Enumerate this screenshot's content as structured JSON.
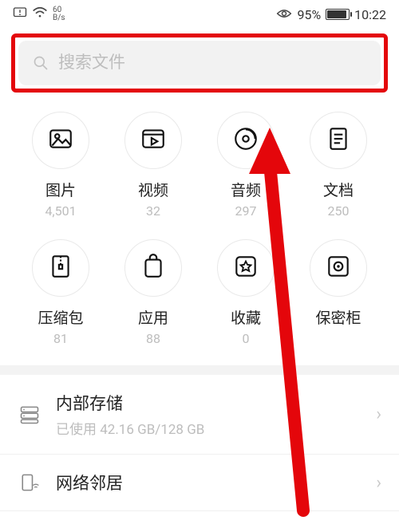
{
  "status": {
    "kbs_top": "60",
    "kbs_bot": "B/s",
    "eye_pct": "95%",
    "battery_fill_pct": 92,
    "time": "10:22"
  },
  "search": {
    "placeholder": "搜索文件"
  },
  "categories": [
    {
      "id": "images",
      "label": "图片",
      "count": "4,501"
    },
    {
      "id": "videos",
      "label": "视频",
      "count": "32"
    },
    {
      "id": "audio",
      "label": "音频",
      "count": "297"
    },
    {
      "id": "docs",
      "label": "文档",
      "count": "250"
    },
    {
      "id": "archives",
      "label": "压缩包",
      "count": "81"
    },
    {
      "id": "apps",
      "label": "应用",
      "count": "88"
    },
    {
      "id": "favs",
      "label": "收藏",
      "count": "0"
    },
    {
      "id": "safe",
      "label": "保密柜",
      "count": ""
    }
  ],
  "storage": {
    "title": "内部存储",
    "sub": "已使用 42.16 GB/128 GB"
  },
  "network": {
    "title": "网络邻居"
  }
}
